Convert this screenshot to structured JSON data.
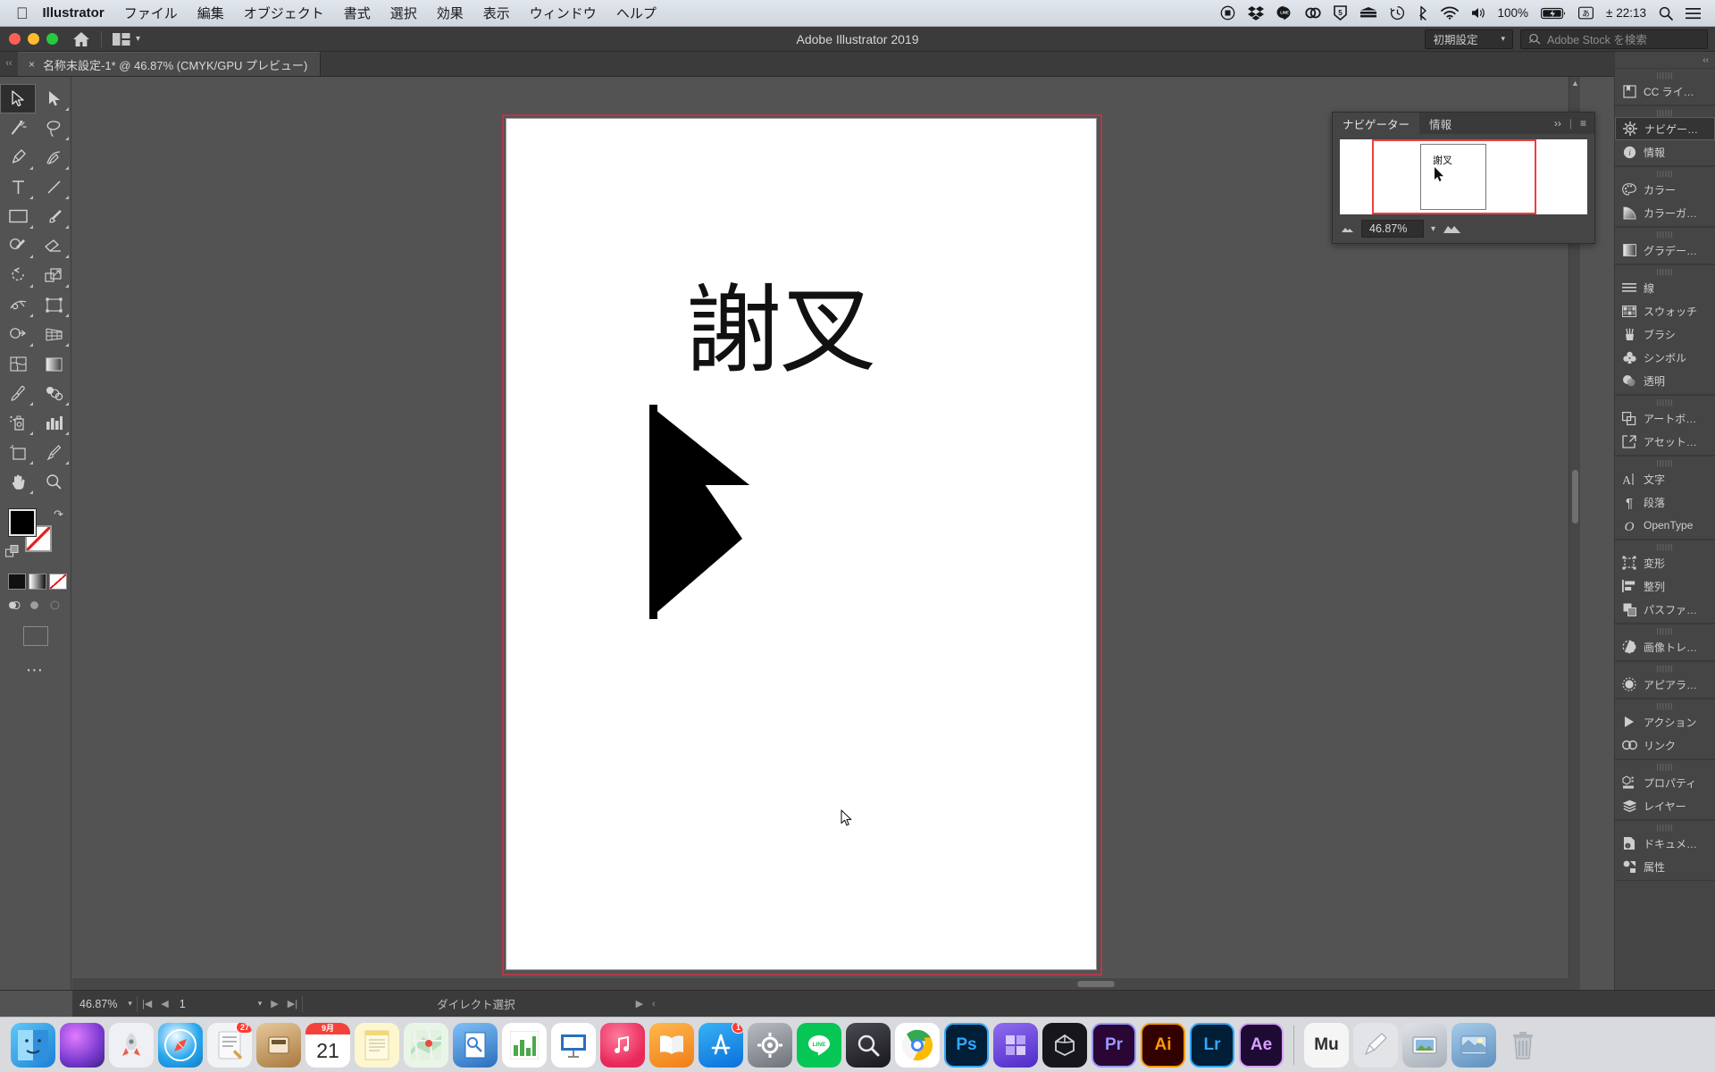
{
  "menubar": {
    "apple_icon": "apple-icon",
    "app_name": "Illustrator",
    "items": [
      "ファイル",
      "編集",
      "オブジェクト",
      "書式",
      "選択",
      "効果",
      "表示",
      "ウィンドウ",
      "ヘルプ"
    ],
    "status_icons": [
      "screen-record-icon",
      "dropbox-icon",
      "line-icon",
      "creative-cloud-icon",
      "html5-icon",
      "server-icon",
      "time-machine-icon",
      "bluetooth-icon",
      "wifi-icon",
      "volume-icon"
    ],
    "battery_percent": "100%",
    "battery_icon": "battery-icon",
    "keyboard_icon": "input-source-icon",
    "date": "± 22:13",
    "spotlight_icon": "search-icon",
    "control_center_icon": "menu-icon"
  },
  "titlebar": {
    "title": "Adobe Illustrator 2019",
    "home_icon": "home-icon",
    "arrange_icon": "arrange-documents-icon",
    "chevron_icon": "chevron-down-icon",
    "workspace": "初期設定",
    "stock_placeholder": "Adobe Stock を検索",
    "stock_icon": "stock-search-icon"
  },
  "tabs": {
    "close_icon": "×",
    "document_title": "名称未設定-1* @ 46.87% (CMYK/GPU プレビュー)",
    "collapse_left_icon": "‹‹",
    "collapse_right_icon": "‹‹"
  },
  "toolbar": {
    "tools": [
      {
        "name": "selection-tool",
        "glyph": "arrow-solid",
        "active": true
      },
      {
        "name": "direct-selection-tool",
        "glyph": "arrow-filled",
        "active": false
      },
      {
        "name": "magic-wand-tool",
        "glyph": "wand",
        "active": false
      },
      {
        "name": "lasso-tool",
        "glyph": "lasso",
        "active": false
      },
      {
        "name": "pen-tool",
        "glyph": "pen",
        "active": false
      },
      {
        "name": "curvature-tool",
        "glyph": "curvature",
        "active": false
      },
      {
        "name": "type-tool",
        "glyph": "T",
        "active": false
      },
      {
        "name": "line-segment-tool",
        "glyph": "line",
        "active": false
      },
      {
        "name": "rectangle-tool",
        "glyph": "rect",
        "active": false
      },
      {
        "name": "paintbrush-tool",
        "glyph": "brush",
        "active": false
      },
      {
        "name": "shaper-tool",
        "glyph": "shaper",
        "active": false
      },
      {
        "name": "eraser-tool",
        "glyph": "eraser",
        "active": false
      },
      {
        "name": "rotate-tool",
        "glyph": "rotate",
        "active": false
      },
      {
        "name": "scale-tool",
        "glyph": "scale",
        "active": false
      },
      {
        "name": "width-tool",
        "glyph": "width",
        "active": false
      },
      {
        "name": "free-transform-tool",
        "glyph": "freetransform",
        "active": false
      },
      {
        "name": "shape-builder-tool",
        "glyph": "shapebuilder",
        "active": false
      },
      {
        "name": "perspective-grid-tool",
        "glyph": "perspective",
        "active": false
      },
      {
        "name": "mesh-tool",
        "glyph": "mesh",
        "active": false
      },
      {
        "name": "gradient-tool",
        "glyph": "gradient",
        "active": false
      },
      {
        "name": "eyedropper-tool",
        "glyph": "eyedropper",
        "active": false
      },
      {
        "name": "blend-tool",
        "glyph": "blend",
        "active": false
      },
      {
        "name": "symbol-sprayer-tool",
        "glyph": "sprayer",
        "active": false
      },
      {
        "name": "column-graph-tool",
        "glyph": "graph",
        "active": false
      },
      {
        "name": "artboard-tool",
        "glyph": "artboard",
        "active": false
      },
      {
        "name": "slice-tool",
        "glyph": "slice",
        "active": false
      },
      {
        "name": "hand-tool",
        "glyph": "hand",
        "active": false
      },
      {
        "name": "zoom-tool",
        "glyph": "zoom",
        "active": false
      }
    ],
    "fill_color": "#000000",
    "stroke_color": "#ffffff",
    "swap_icon": "swap-fill-stroke-icon",
    "default_icon": "default-fill-stroke-icon",
    "color_mode_icons": [
      "color-swatch-icon",
      "gradient-icon",
      "none-icon"
    ],
    "drawing_mode_icons": [
      "draw-normal-icon",
      "draw-behind-icon",
      "draw-inside-icon"
    ],
    "screen_mode_icon": "change-screen-mode-icon",
    "more_icon": "more-tools-icon"
  },
  "canvas": {
    "glyph_text": "謝叉",
    "arrow_shape_name": "black-arrow-shape",
    "cursor_name": "mouse-pointer",
    "bleed_color": "#b03a4a"
  },
  "navigator": {
    "tabs": [
      {
        "label": "ナビゲーター",
        "active": true
      },
      {
        "label": "情報",
        "active": false
      }
    ],
    "expand_icon": "››",
    "divider": "|",
    "menu_icon": "≡",
    "thumb_glyph": "謝叉",
    "zoom_out_icon": "zoom-out-icon",
    "zoom_value": "46.87%",
    "zoom_dropdown_icon": "chevron-down-icon",
    "zoom_in_icon": "zoom-in-icon",
    "view_box_color": "#f03e3e"
  },
  "dock_panels": {
    "collapse_icon": "‹‹",
    "groups": [
      {
        "items": [
          {
            "label": "CC ライ…",
            "icon": "cc-libraries-icon",
            "active": false
          }
        ]
      },
      {
        "items": [
          {
            "label": "ナビゲー…",
            "icon": "navigator-icon",
            "active": true
          },
          {
            "label": "情報",
            "icon": "info-icon",
            "active": false
          }
        ]
      },
      {
        "items": [
          {
            "label": "カラー",
            "icon": "color-palette-icon",
            "active": false
          },
          {
            "label": "カラーガ…",
            "icon": "color-guide-icon",
            "active": false
          }
        ]
      },
      {
        "items": [
          {
            "label": "グラデー…",
            "icon": "gradient-icon",
            "active": false
          }
        ]
      },
      {
        "items": [
          {
            "label": "線",
            "icon": "stroke-icon",
            "active": false
          },
          {
            "label": "スウォッチ",
            "icon": "swatches-icon",
            "active": false
          },
          {
            "label": "ブラシ",
            "icon": "brushes-icon",
            "active": false
          },
          {
            "label": "シンボル",
            "icon": "symbols-icon",
            "active": false
          },
          {
            "label": "透明",
            "icon": "transparency-icon",
            "active": false
          }
        ]
      },
      {
        "items": [
          {
            "label": "アートボ…",
            "icon": "artboards-icon",
            "active": false
          },
          {
            "label": "アセット…",
            "icon": "asset-export-icon",
            "active": false
          }
        ]
      },
      {
        "items": [
          {
            "label": "文字",
            "icon": "character-icon",
            "active": false
          },
          {
            "label": "段落",
            "icon": "paragraph-icon",
            "active": false
          },
          {
            "label": "OpenType",
            "icon": "opentype-icon",
            "active": false
          }
        ]
      },
      {
        "items": [
          {
            "label": "変形",
            "icon": "transform-icon",
            "active": false
          },
          {
            "label": "整列",
            "icon": "align-icon",
            "active": false
          },
          {
            "label": "パスファ…",
            "icon": "pathfinder-icon",
            "active": false
          }
        ]
      },
      {
        "items": [
          {
            "label": "画像トレ…",
            "icon": "image-trace-icon",
            "active": false
          }
        ]
      },
      {
        "items": [
          {
            "label": "アピアラ…",
            "icon": "appearance-icon",
            "active": false
          }
        ]
      },
      {
        "items": [
          {
            "label": "アクション",
            "icon": "actions-icon",
            "active": false
          },
          {
            "label": "リンク",
            "icon": "links-icon",
            "active": false
          }
        ]
      },
      {
        "items": [
          {
            "label": "プロパティ",
            "icon": "properties-icon",
            "active": false
          },
          {
            "label": "レイヤー",
            "icon": "layers-icon",
            "active": false
          }
        ]
      },
      {
        "items": [
          {
            "label": "ドキュメ…",
            "icon": "document-info-icon",
            "active": false
          },
          {
            "label": "属性",
            "icon": "attributes-icon",
            "active": false
          }
        ]
      }
    ]
  },
  "statusbar": {
    "zoom_value": "46.87%",
    "zoom_dropdown_icon": "chevron-down-icon",
    "first_page_icon": "|◀",
    "prev_page_icon": "◀",
    "page_number": "1",
    "page_dropdown_icon": "chevron-down-icon",
    "next_page_icon": "▶",
    "last_page_icon": "▶|",
    "status_text": "ダイレクト選択",
    "status_menu_icon": "▶",
    "resize_icon": "‹"
  },
  "macdock": {
    "apps": [
      {
        "name": "finder",
        "label": "",
        "color": "#2196f3",
        "badge": ""
      },
      {
        "name": "siri",
        "label": "",
        "color": "#b660e0",
        "badge": ""
      },
      {
        "name": "launchpad",
        "label": "",
        "color": "#d8dbe0",
        "badge": ""
      },
      {
        "name": "safari",
        "label": "",
        "color": "#1fa8f0",
        "badge": ""
      },
      {
        "name": "mail-or-notes",
        "label": "",
        "color": "#e8eaed",
        "badge": "27"
      },
      {
        "name": "app-store-utility",
        "label": "",
        "color": "#c8a882",
        "badge": ""
      },
      {
        "name": "calendar",
        "label": "21",
        "color": "#ffffff",
        "badge": ""
      },
      {
        "name": "notes",
        "label": "",
        "color": "#fdf3c0",
        "badge": ""
      },
      {
        "name": "maps",
        "label": "",
        "color": "#e9f5e5",
        "badge": ""
      },
      {
        "name": "preview",
        "label": "",
        "color": "#3f85d8",
        "badge": ""
      },
      {
        "name": "numbers",
        "label": "",
        "color": "#ffffff",
        "badge": ""
      },
      {
        "name": "keynote",
        "label": "",
        "color": "#ffffff",
        "badge": ""
      },
      {
        "name": "itunes",
        "label": "",
        "color": "#fc3c66",
        "badge": ""
      },
      {
        "name": "books",
        "label": "",
        "color": "#f9952d",
        "badge": ""
      },
      {
        "name": "app-store",
        "label": "",
        "color": "#1d8ef5",
        "badge": "1"
      },
      {
        "name": "system-preferences",
        "label": "",
        "color": "#8e9095",
        "badge": ""
      },
      {
        "name": "line",
        "label": "LINE",
        "color": "#06c755",
        "badge": ""
      },
      {
        "name": "alfred",
        "label": "",
        "color": "#2a2a2e",
        "badge": ""
      },
      {
        "name": "chrome",
        "label": "",
        "color": "#ffffff",
        "badge": ""
      },
      {
        "name": "photoshop",
        "label": "Ps",
        "color": "#001e36",
        "badge": ""
      },
      {
        "name": "compressor",
        "label": "",
        "color": "#6a4fd8",
        "badge": ""
      },
      {
        "name": "cinema4d",
        "label": "",
        "color": "#1d1d20",
        "badge": ""
      },
      {
        "name": "premiere-pro",
        "label": "Pr",
        "color": "#2a0634",
        "badge": ""
      },
      {
        "name": "illustrator",
        "label": "Ai",
        "color": "#330000",
        "badge": ""
      },
      {
        "name": "lightroom",
        "label": "Lr",
        "color": "#001e36",
        "badge": ""
      },
      {
        "name": "after-effects",
        "label": "Ae",
        "color": "#1d0b33",
        "badge": ""
      },
      {
        "name": "separator",
        "label": "",
        "color": "",
        "badge": ""
      },
      {
        "name": "muse",
        "label": "Mu",
        "color": "#f5f5f5",
        "badge": ""
      },
      {
        "name": "sketchbook",
        "label": "",
        "color": "#d9d9d9",
        "badge": ""
      },
      {
        "name": "image-capture",
        "label": "",
        "color": "#c7ccd3",
        "badge": ""
      },
      {
        "name": "downloads-stack",
        "label": "",
        "color": "#7fa8cf",
        "badge": ""
      },
      {
        "name": "trash",
        "label": "",
        "color": "#b9bec6",
        "badge": ""
      }
    ]
  }
}
